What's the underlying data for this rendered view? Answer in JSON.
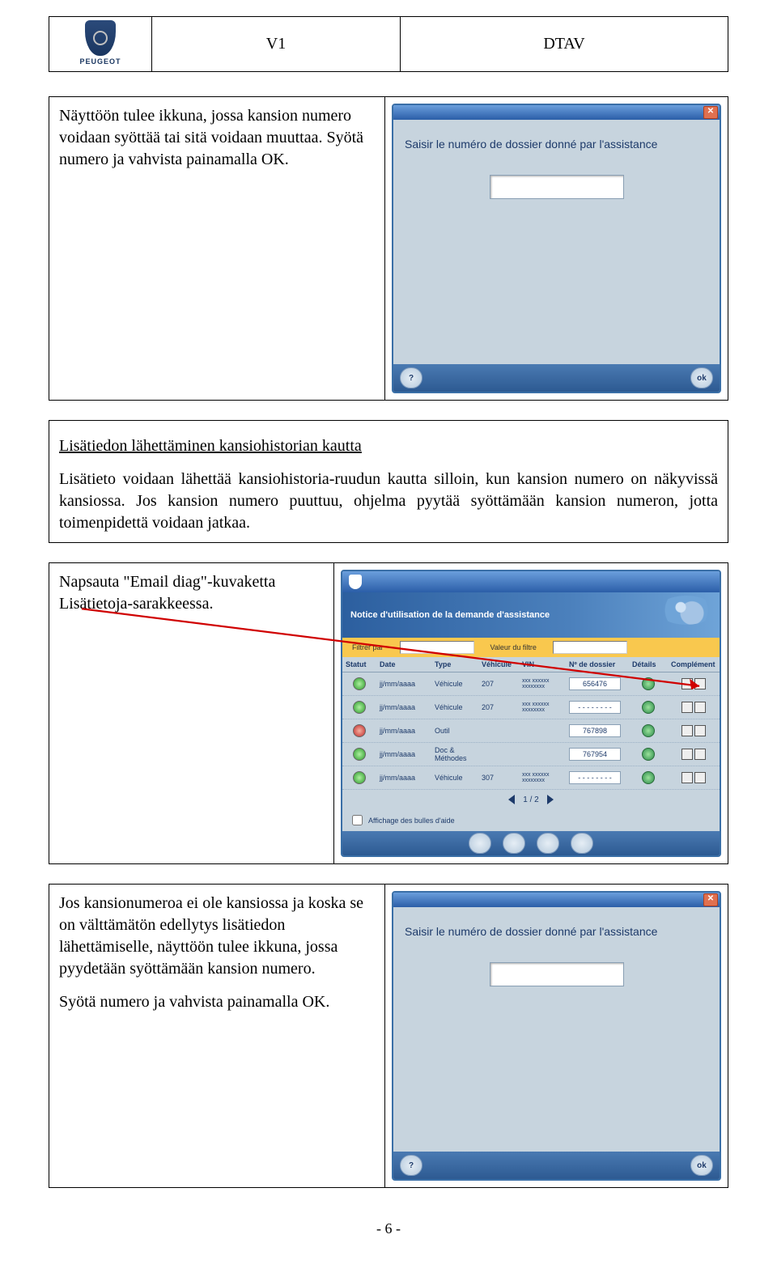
{
  "header": {
    "center": "V1",
    "right": "DTAV",
    "logo_text": "PEUGEOT"
  },
  "block1": {
    "text": "Näyttöön tulee ikkuna, jossa kansion numero voidaan syöttää tai sitä voidaan muuttaa. Syötä numero ja vahvista painamalla OK."
  },
  "dialog": {
    "prompt": "Saisir le numéro de dossier donné par l'assistance",
    "input_value": "",
    "close_label": "✕",
    "left_icon": "?",
    "ok_label": "ok"
  },
  "section2": {
    "title": "Lisätiedon lähettäminen kansiohistorian kautta",
    "p1": "Lisätieto voidaan lähettää kansiohistoria-ruudun kautta silloin, kun kansion numero on näkyvissä kansiossa. Jos kansion numero puuttuu, ohjelma pyytää syöttämään kansion numeron, jotta toimenpidettä voidaan jatkaa."
  },
  "block3": {
    "text": "Napsauta \"Email diag\"-kuvaketta Lisätietoja-sarakkeessa."
  },
  "history": {
    "banner": "Notice d'utilisation de la demande d'assistance",
    "filter_label": "Filtrer par",
    "filter_value_label": "Valeur du filtre",
    "columns": [
      "Statut",
      "Date",
      "Type",
      "Véhicule",
      "VIN",
      "Nº de dossier",
      "Détails",
      "Complément"
    ],
    "rows": [
      {
        "statut": "green",
        "date": "jj/mm/aaaa",
        "type": "Véhicule",
        "veh": "207",
        "vin": "xxx xxxxxx xxxxxxxx",
        "dossier": "656476"
      },
      {
        "statut": "green",
        "date": "jj/mm/aaaa",
        "type": "Véhicule",
        "veh": "207",
        "vin": "xxx xxxxxx xxxxxxxx",
        "dossier": "- - - - - - - -"
      },
      {
        "statut": "red",
        "date": "jj/mm/aaaa",
        "type": "Outil",
        "veh": "",
        "vin": "",
        "dossier": "767898"
      },
      {
        "statut": "green",
        "date": "jj/mm/aaaa",
        "type": "Doc & Méthodes",
        "veh": "",
        "vin": "",
        "dossier": "767954"
      },
      {
        "statut": "green",
        "date": "jj/mm/aaaa",
        "type": "Véhicule",
        "veh": "307",
        "vin": "xxx xxxxxx xxxxxxxx",
        "dossier": "- - - - - - - -"
      }
    ],
    "pager": "1 / 2",
    "help_label": "Affichage des bulles d'aide"
  },
  "block4": {
    "p1": "Jos kansionumeroa ei ole kansiossa ja koska se on välttämätön edellytys lisätiedon lähettämiselle, näyttöön tulee ikkuna, jossa pyydetään syöttämään kansion numero.",
    "p2": "Syötä numero ja vahvista painamalla OK."
  },
  "page_number": "- 6 -"
}
